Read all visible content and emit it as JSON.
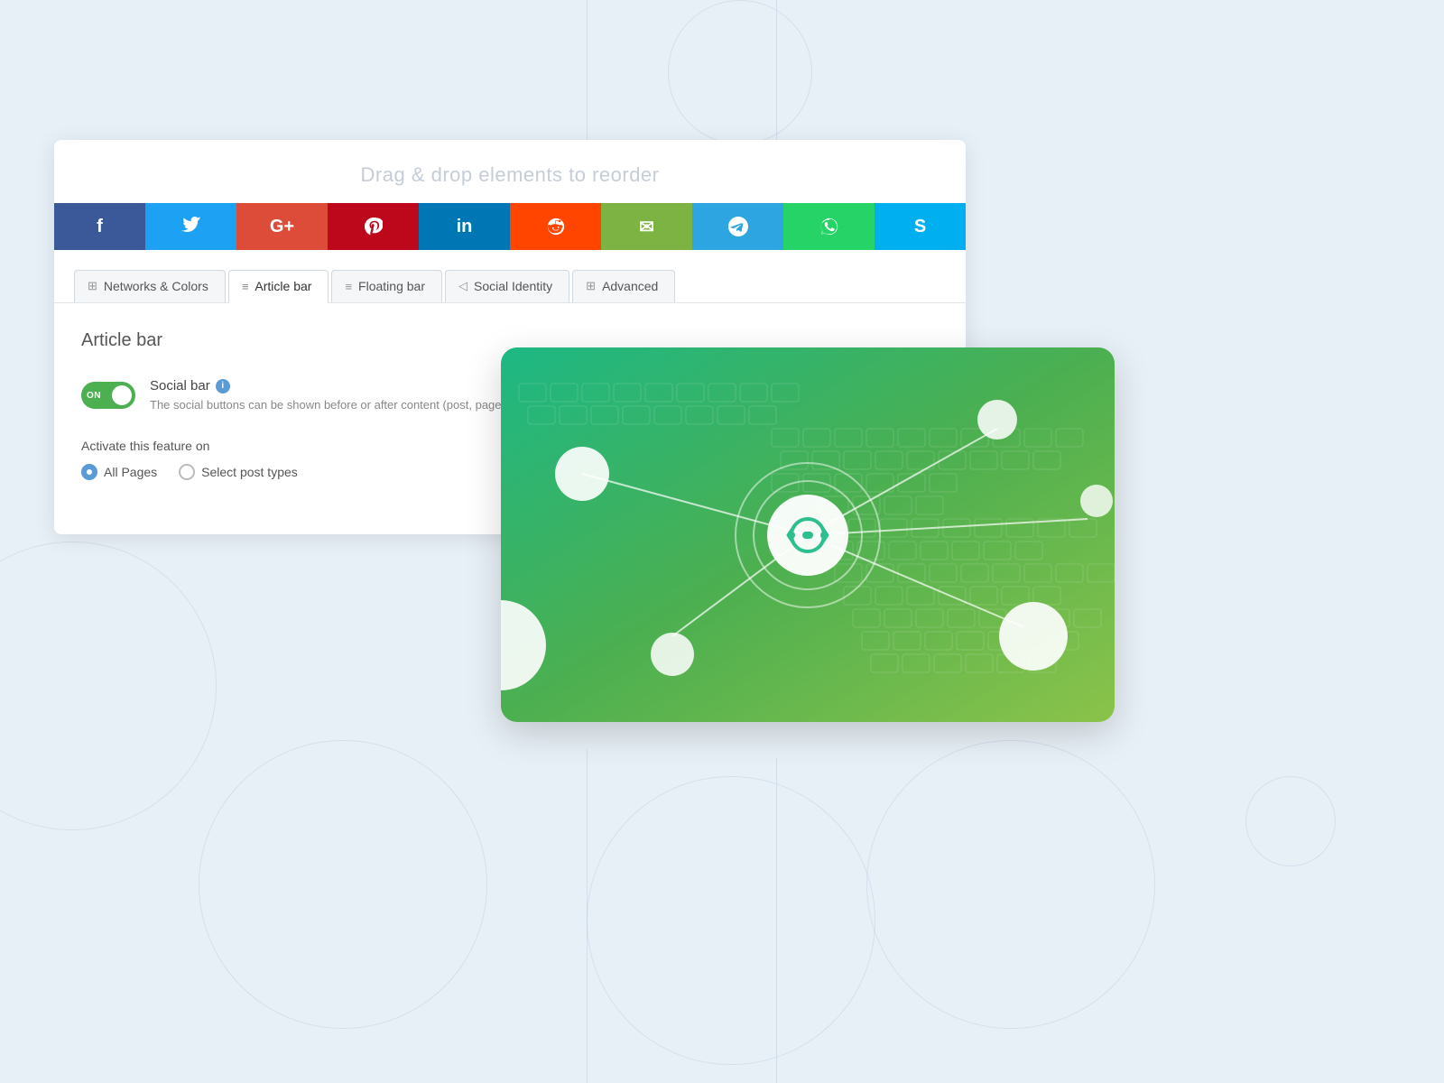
{
  "page": {
    "drag_drop_label": "Drag & drop elements to reorder",
    "background_color": "#e8f0f7"
  },
  "social_buttons": [
    {
      "name": "facebook",
      "icon": "f",
      "color": "#3b5998"
    },
    {
      "name": "twitter",
      "icon": "𝕥",
      "color": "#1da1f2"
    },
    {
      "name": "google-plus",
      "icon": "G+",
      "color": "#dd4b39"
    },
    {
      "name": "pinterest",
      "icon": "𝐩",
      "color": "#bd081c"
    },
    {
      "name": "linkedin",
      "icon": "in",
      "color": "#0077b5"
    },
    {
      "name": "reddit",
      "icon": "●",
      "color": "#ff4500"
    },
    {
      "name": "email",
      "icon": "✉",
      "color": "#7cb342"
    },
    {
      "name": "telegram",
      "icon": "➤",
      "color": "#2ca5e0"
    },
    {
      "name": "whatsapp",
      "icon": "✆",
      "color": "#25d366"
    },
    {
      "name": "skype",
      "icon": "S",
      "color": "#00aff0"
    }
  ],
  "tabs": [
    {
      "id": "networks",
      "label": "Networks & Colors",
      "icon": "⊞",
      "active": false
    },
    {
      "id": "article",
      "label": "Article bar",
      "icon": "≡",
      "active": true
    },
    {
      "id": "floating",
      "label": "Floating bar",
      "icon": "≡",
      "active": false
    },
    {
      "id": "social-identity",
      "label": "Social Identity",
      "icon": "◁",
      "active": false
    },
    {
      "id": "advanced",
      "label": "Advanced",
      "icon": "⊞",
      "active": false
    }
  ],
  "content": {
    "section_title": "Article bar",
    "toggle": {
      "state": "ON",
      "label": "Social bar",
      "description": "The social buttons can be shown before or after content (post, page, custo..."
    },
    "activate": {
      "label": "Activate this feature on",
      "options": [
        {
          "id": "all-pages",
          "label": "All Pages",
          "selected": true
        },
        {
          "id": "select-post-types",
          "label": "Select post types",
          "selected": false
        }
      ]
    }
  }
}
